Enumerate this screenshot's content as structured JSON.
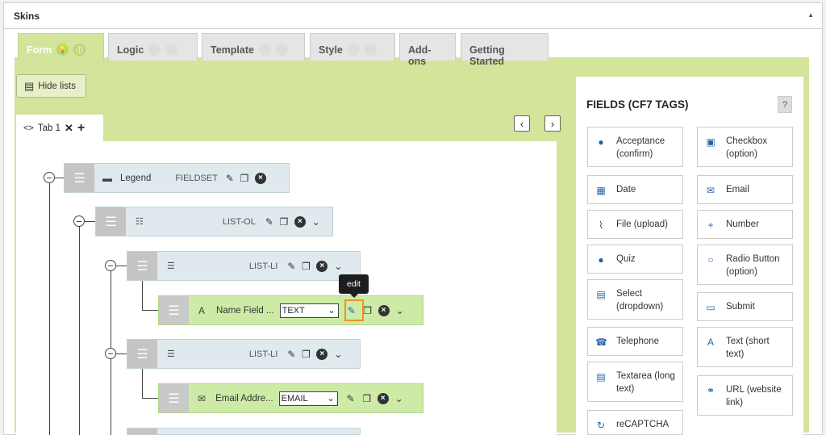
{
  "panel": {
    "title": "Skins"
  },
  "tabs": [
    {
      "label": "Form",
      "active": true,
      "has_icons": true
    },
    {
      "label": "Logic",
      "has_icons": true
    },
    {
      "label": "Template",
      "has_icons": true
    },
    {
      "label": "Style",
      "has_icons": true
    },
    {
      "label": "Add-ons"
    },
    {
      "label": "Getting Started"
    }
  ],
  "toolbar": {
    "hide_lists_label": "Hide lists"
  },
  "editor_tab": {
    "label": "Tab 1"
  },
  "nodes": {
    "legend": {
      "label": "Legend",
      "type": "FIELDSET"
    },
    "list_ol": {
      "type": "LIST-OL"
    },
    "list_li_1": {
      "type": "LIST-LI"
    },
    "name_field": {
      "label": "Name Field ...",
      "select_value": "TEXT"
    },
    "list_li_2": {
      "type": "LIST-LI"
    },
    "email_field": {
      "label": "Email Addre...",
      "select_value": "EMAIL"
    }
  },
  "tooltip": {
    "text": "edit"
  },
  "sidebar": {
    "title": "FIELDS (CF7 TAGS)",
    "help": "?",
    "fields_left": [
      {
        "label": "Acceptance (confirm)",
        "icon": "check-circle-icon"
      },
      {
        "label": "Date",
        "icon": "calendar-icon"
      },
      {
        "label": "File (upload)",
        "icon": "paperclip-icon"
      },
      {
        "label": "Quiz",
        "icon": "question-circle-icon"
      },
      {
        "label": "Select (dropdown)",
        "icon": "list-icon"
      },
      {
        "label": "Telephone",
        "icon": "phone-icon"
      },
      {
        "label": "Textarea (long text)",
        "icon": "textarea-icon"
      },
      {
        "label": "reCAPTCHA",
        "icon": "refresh-icon"
      }
    ],
    "fields_right": [
      {
        "label": "Checkbox (option)",
        "icon": "checkbox-icon"
      },
      {
        "label": "Email",
        "icon": "envelope-icon"
      },
      {
        "label": "Number",
        "icon": "plus-icon"
      },
      {
        "label": "Radio Button (option)",
        "icon": "radio-icon"
      },
      {
        "label": "Submit",
        "icon": "button-icon"
      },
      {
        "label": "Text (short text)",
        "icon": "text-icon"
      },
      {
        "label": "URL (website link)",
        "icon": "link-icon"
      }
    ]
  },
  "colors": {
    "accent_green": "#d3e49b",
    "highlight_orange": "#f0902a",
    "icon_blue": "#2563a8"
  }
}
